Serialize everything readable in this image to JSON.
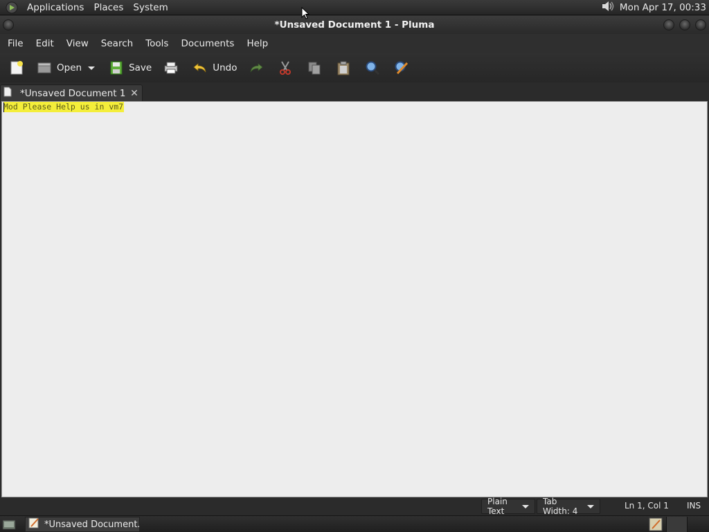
{
  "top_panel": {
    "menu": [
      "Applications",
      "Places",
      "System"
    ],
    "clock": "Mon Apr 17, 00:33",
    "volume_icon": "speaker-icon"
  },
  "window": {
    "title": "*Unsaved Document 1 - Pluma"
  },
  "menubar": [
    "File",
    "Edit",
    "View",
    "Search",
    "Tools",
    "Documents",
    "Help"
  ],
  "toolbar": {
    "open_label": "Open",
    "save_label": "Save",
    "undo_label": "Undo"
  },
  "tab": {
    "label": "*Unsaved Document 1"
  },
  "editor": {
    "text": "Mod Please Help us in vm7",
    "highlight_color": "#f4ee3a"
  },
  "statusbar": {
    "language": "Plain Text",
    "tab_width": "Tab Width:  4",
    "position": "Ln 1, Col 1",
    "mode": "INS"
  },
  "taskbar": {
    "task_label": "*Unsaved Document..."
  }
}
